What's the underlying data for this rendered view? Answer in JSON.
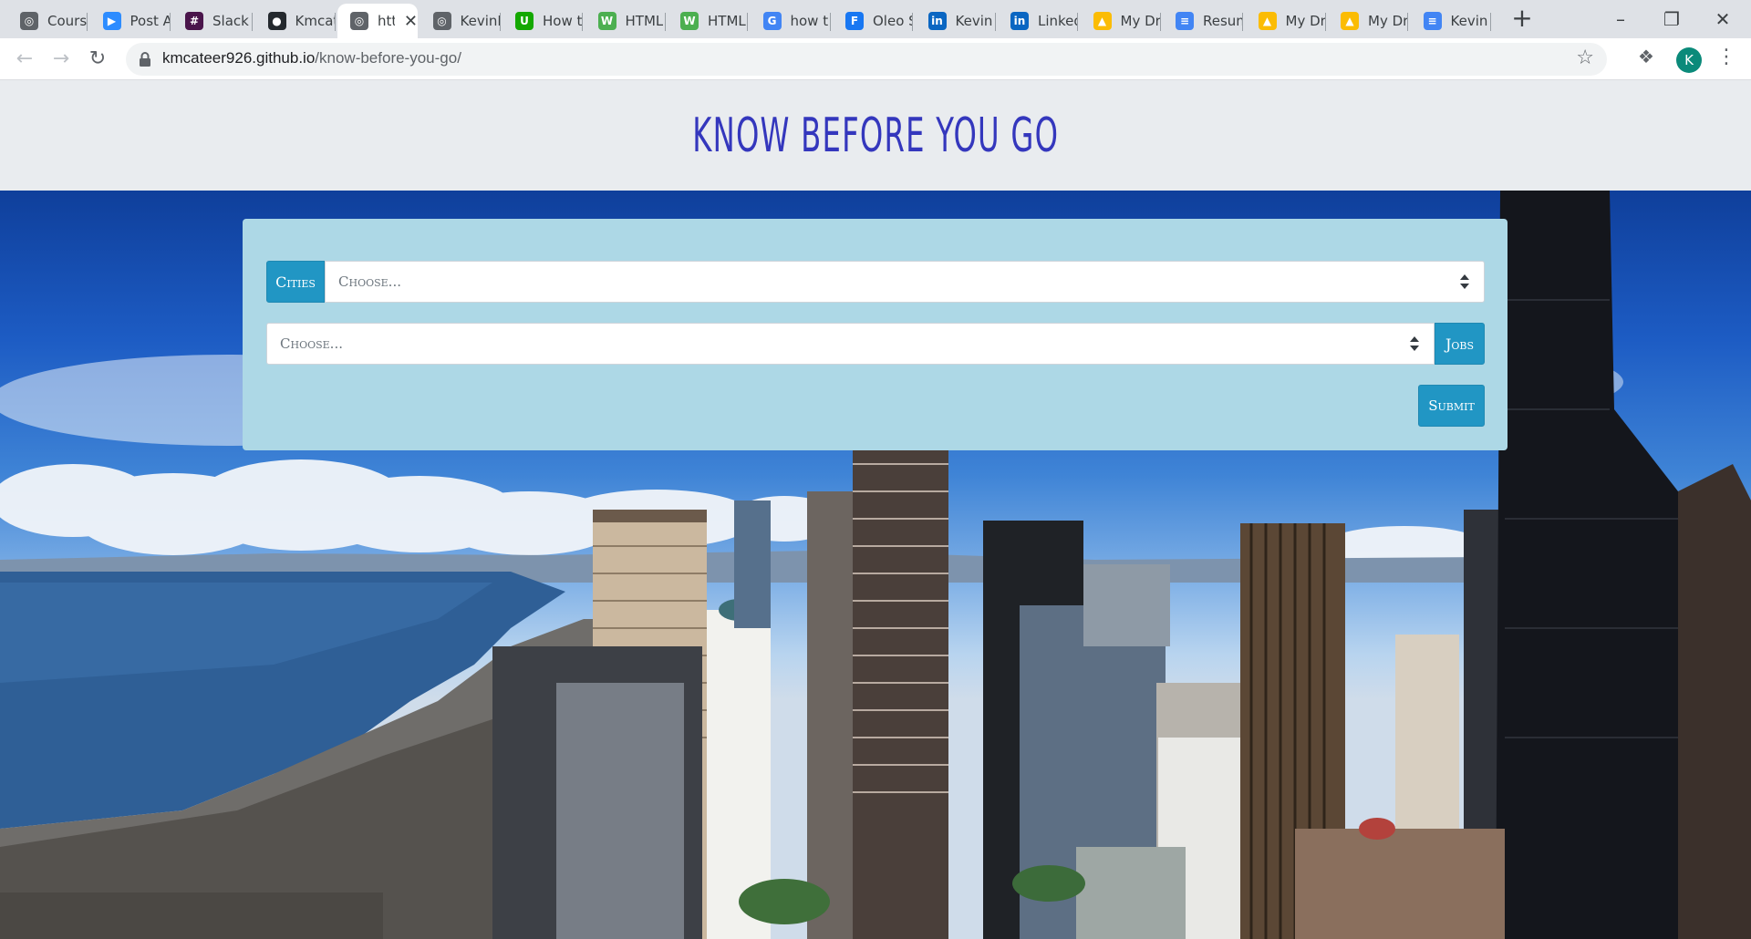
{
  "browser": {
    "tabs": [
      {
        "title": "Courses",
        "favicon": "globe-icon",
        "color": "#5f6368"
      },
      {
        "title": "Post A",
        "favicon": "zoom-icon",
        "color": "#2d8cff"
      },
      {
        "title": "Slack |",
        "favicon": "slack-icon",
        "color": "#4a154b"
      },
      {
        "title": "Kmcat",
        "favicon": "github-icon",
        "color": "#24292e"
      },
      {
        "title": "htt",
        "favicon": "globe-icon",
        "color": "#5f6368",
        "active": true
      },
      {
        "title": "KevinM",
        "favicon": "globe-icon",
        "color": "#5f6368"
      },
      {
        "title": "How t",
        "favicon": "upwork-icon",
        "color": "#14a800"
      },
      {
        "title": "HTML",
        "favicon": "w3schools-icon",
        "color": "#4caf50"
      },
      {
        "title": "HTML",
        "favicon": "w3schools-icon",
        "color": "#4caf50"
      },
      {
        "title": "how t",
        "favicon": "google-icon",
        "color": "#4285f4"
      },
      {
        "title": "Oleo S",
        "favicon": "facebook-icon",
        "color": "#1877f2"
      },
      {
        "title": "Kevin",
        "favicon": "linkedin-icon",
        "color": "#0a66c2"
      },
      {
        "title": "Linked",
        "favicon": "linkedin-icon",
        "color": "#0a66c2"
      },
      {
        "title": "My Dr",
        "favicon": "drive-icon",
        "color": "#fbbc04"
      },
      {
        "title": "Resum",
        "favicon": "docs-icon",
        "color": "#4285f4"
      },
      {
        "title": "My Dr",
        "favicon": "drive-icon",
        "color": "#fbbc04"
      },
      {
        "title": "My Dr",
        "favicon": "drive-icon",
        "color": "#fbbc04"
      },
      {
        "title": "Kevin",
        "favicon": "docs-icon",
        "color": "#4285f4"
      }
    ],
    "url_host": "kmcateer926.github.io",
    "url_path": "/know-before-you-go/",
    "avatar_letter": "K"
  },
  "page": {
    "title": "KNOW BEFORE YOU GO",
    "form": {
      "cities_label": "Cities",
      "cities_value": "Choose...",
      "jobs_value": "Choose...",
      "jobs_label": "Jobs",
      "submit_label": "Submit"
    }
  },
  "colors": {
    "title": "#3437bd",
    "header_bg": "#e9ecef",
    "panel_bg": "#add8e6",
    "button": "#2196c4"
  }
}
